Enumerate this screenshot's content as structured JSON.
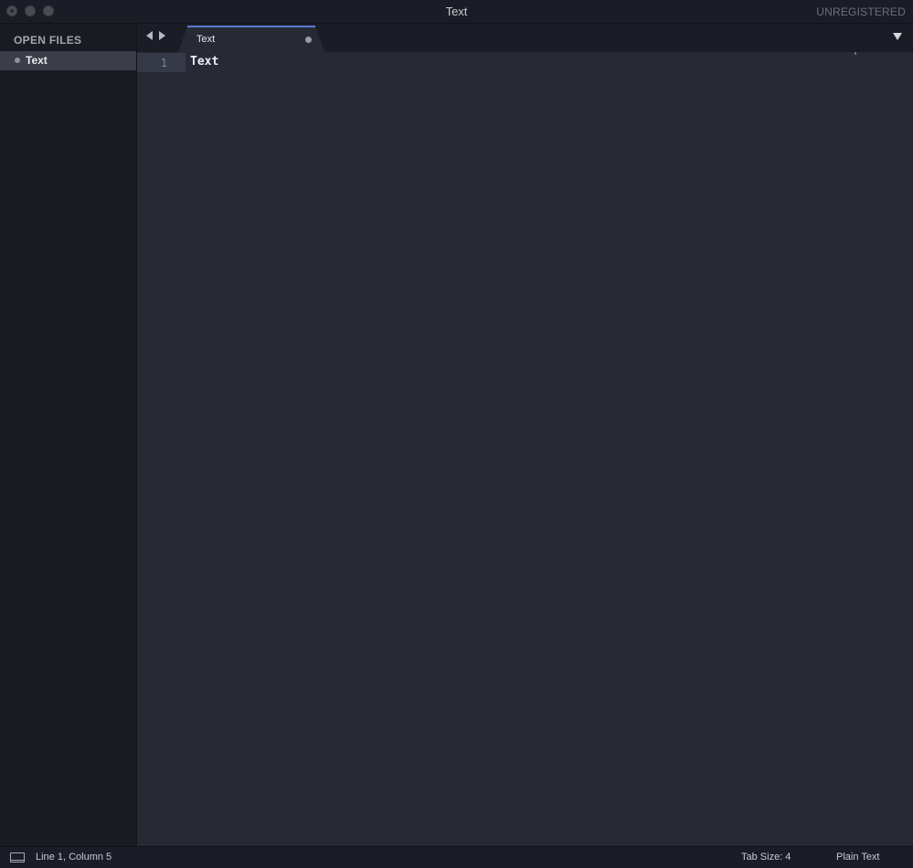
{
  "window": {
    "title": "Text",
    "registration": "UNREGISTERED"
  },
  "sidebar": {
    "heading": "OPEN FILES",
    "files": [
      {
        "label": "Text",
        "active": true,
        "modified": true
      }
    ]
  },
  "tabs": [
    {
      "label": "Text",
      "active": true,
      "modified": true
    }
  ],
  "editor": {
    "lines": [
      {
        "number": "1",
        "text": "Text"
      }
    ]
  },
  "statusbar": {
    "position": "Line 1, Column 5",
    "tab_size": "Tab Size: 4",
    "syntax": "Plain Text"
  },
  "icons": {
    "close": "close-icon",
    "minimize": "minimize-icon",
    "maximize": "maximize-icon",
    "nav_back": "arrow-left-icon",
    "nav_forward": "arrow-right-icon",
    "tab_list": "chevron-down-icon",
    "dirty": "modified-dot-icon",
    "panel": "panel-toggle-icon"
  },
  "colors": {
    "editor_bg": "#272a35",
    "sidebar_bg": "#191a22",
    "tab_accent": "#5f7bd1",
    "selected_row": "#3b3e48"
  }
}
